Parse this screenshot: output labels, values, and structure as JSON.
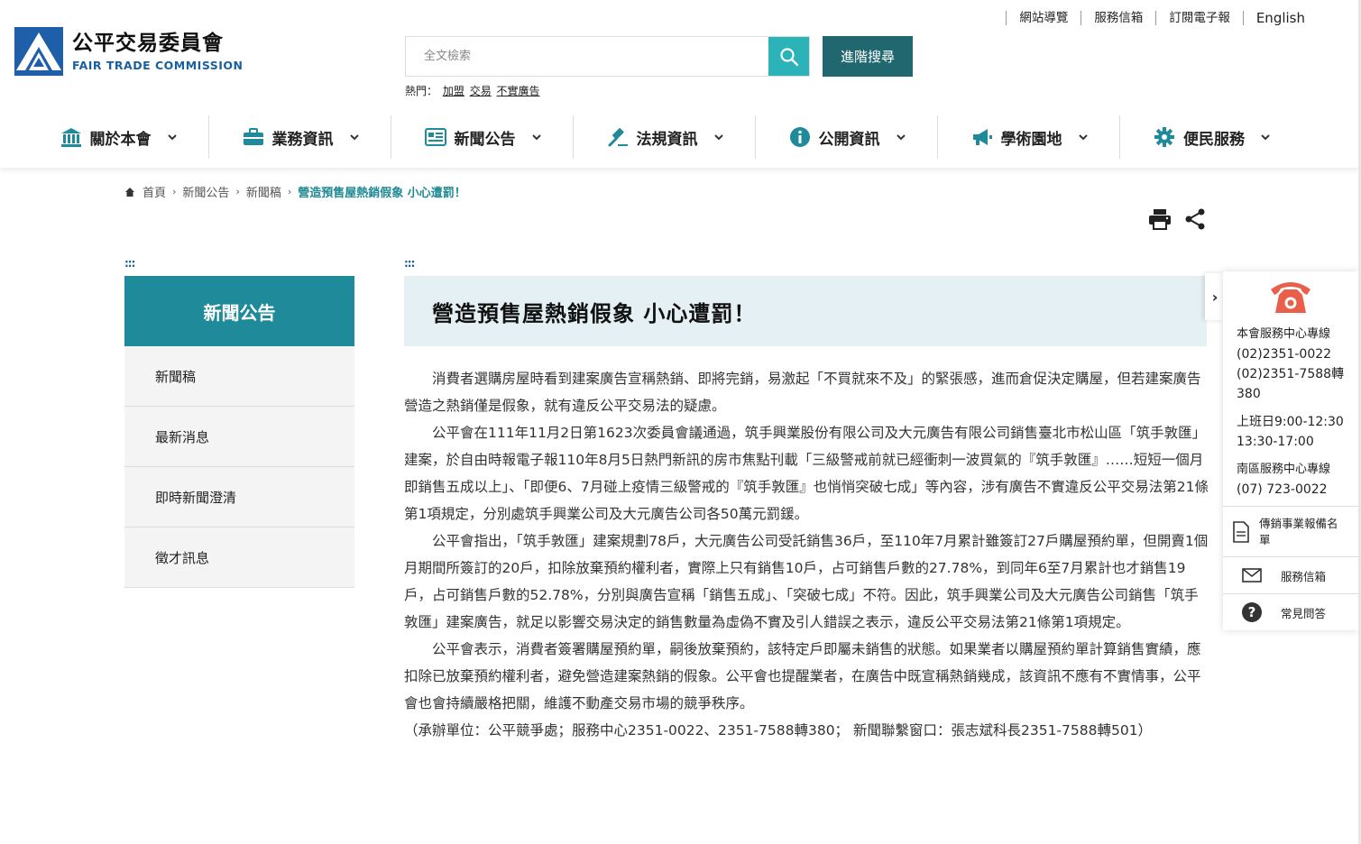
{
  "header": {
    "logo_cn": "公平交易委員會",
    "logo_en": "FAIR TRADE COMMISSION",
    "top_links": [
      "網站導覽",
      "服務信箱",
      "訂閱電子報",
      "English"
    ],
    "search_placeholder": "全文檢索",
    "advanced_search": "進階搜尋",
    "hot_label": "熱門：",
    "hot_terms": [
      "加盟",
      "交易",
      "不實廣告"
    ]
  },
  "nav": {
    "items": [
      {
        "label": "關於本會",
        "icon": "building-icon"
      },
      {
        "label": "業務資訊",
        "icon": "briefcase-icon"
      },
      {
        "label": "新聞公告",
        "icon": "newspaper-icon"
      },
      {
        "label": "法規資訊",
        "icon": "gavel-icon"
      },
      {
        "label": "公開資訊",
        "icon": "info-icon"
      },
      {
        "label": "學術園地",
        "icon": "megaphone-icon"
      },
      {
        "label": "便民服務",
        "icon": "gear-icon"
      }
    ]
  },
  "breadcrumb": {
    "items": [
      "首頁",
      "新聞公告",
      "新聞稿"
    ],
    "current": "營造預售屋熱銷假象 小心遭罰！"
  },
  "anchor": ":::",
  "sidebar": {
    "title": "新聞公告",
    "items": [
      "新聞稿",
      "最新消息",
      "即時新聞澄清",
      "徵才訊息"
    ]
  },
  "article": {
    "title": "營造預售屋熱銷假象 小心遭罰！",
    "paragraphs": [
      "消費者選購房屋時看到建案廣告宣稱熱銷、即將完銷，易激起「不買就來不及」的緊張感，進而倉促決定購屋，但若建案廣告營造之熱銷僅是假象，就有違反公平交易法的疑慮。",
      "公平會在111年11月2日第1623次委員會議通過，筑手興業股份有限公司及大元廣告有限公司銷售臺北市松山區「筑手敦匯」建案，於自由時報電子報110年8月5日熱門新訊的房市焦點刊載「三級警戒前就已經衝刺一波買氣的『筑手敦匯』……短短一個月即銷售五成以上」、「即便6、7月碰上疫情三級警戒的『筑手敦匯』也悄悄突破七成」等內容，涉有廣告不實違反公平交易法第21條第1項規定，分別處筑手興業公司及大元廣告公司各50萬元罰鍰。",
      "公平會指出，「筑手敦匯」建案規劃78戶，大元廣告公司受託銷售36戶，至110年7月累計雖簽訂27戶購屋預約單，但開賣1個月期間所簽訂的20戶，扣除放棄預約權利者，實際上只有銷售10戶，占可銷售戶數的27.78%，到同年6至7月累計也才銷售19戶，占可銷售戶數的52.78%，分別與廣告宣稱「銷售五成」、「突破七成」不符。因此，筑手興業公司及大元廣告公司銷售「筑手敦匯」建案廣告，就足以影響交易決定的銷售數量為虛偽不實及引人錯誤之表示，違反公平交易法第21條第1項規定。",
      "公平會表示，消費者簽署購屋預約單，嗣後放棄預約，該特定戶即屬未銷售的狀態。如果業者以購屋預約單計算銷售實績，應扣除已放棄預約權利者，避免營造建案熱銷的假象。公平會也提醒業者，在廣告中既宣稱熱銷幾成，該資訊不應有不實情事，公平會也會持續嚴格把關，維護不動產交易市場的競爭秩序。"
    ],
    "contact": "（承辦單位：公平競爭處；服務中心2351-0022、2351-7588轉380； 新聞聯繫窗口：張志斌科長2351-7588轉501）"
  },
  "float_panel": {
    "toggle": "›",
    "hotline_title": "本會服務中心專線",
    "hotline_1": "(02)2351-0022",
    "hotline_2": "(02)2351-7588轉",
    "hotline_ext": "380",
    "hours_1": "上班日9:00-12:30",
    "hours_2": "13:30-17:00",
    "south_title": "南區服務中心專線",
    "south_phone": "(07) 723-0022",
    "btn_register": "傳銷事業報備名單",
    "btn_mail": "服務信箱",
    "btn_faq": "常見問答"
  },
  "colors": {
    "teal": "#1f8a9a",
    "dark_teal": "#20676f",
    "search_teal": "#2bb3b9",
    "title_bg": "#e4f0f4",
    "phone_red": "#e8604c"
  }
}
